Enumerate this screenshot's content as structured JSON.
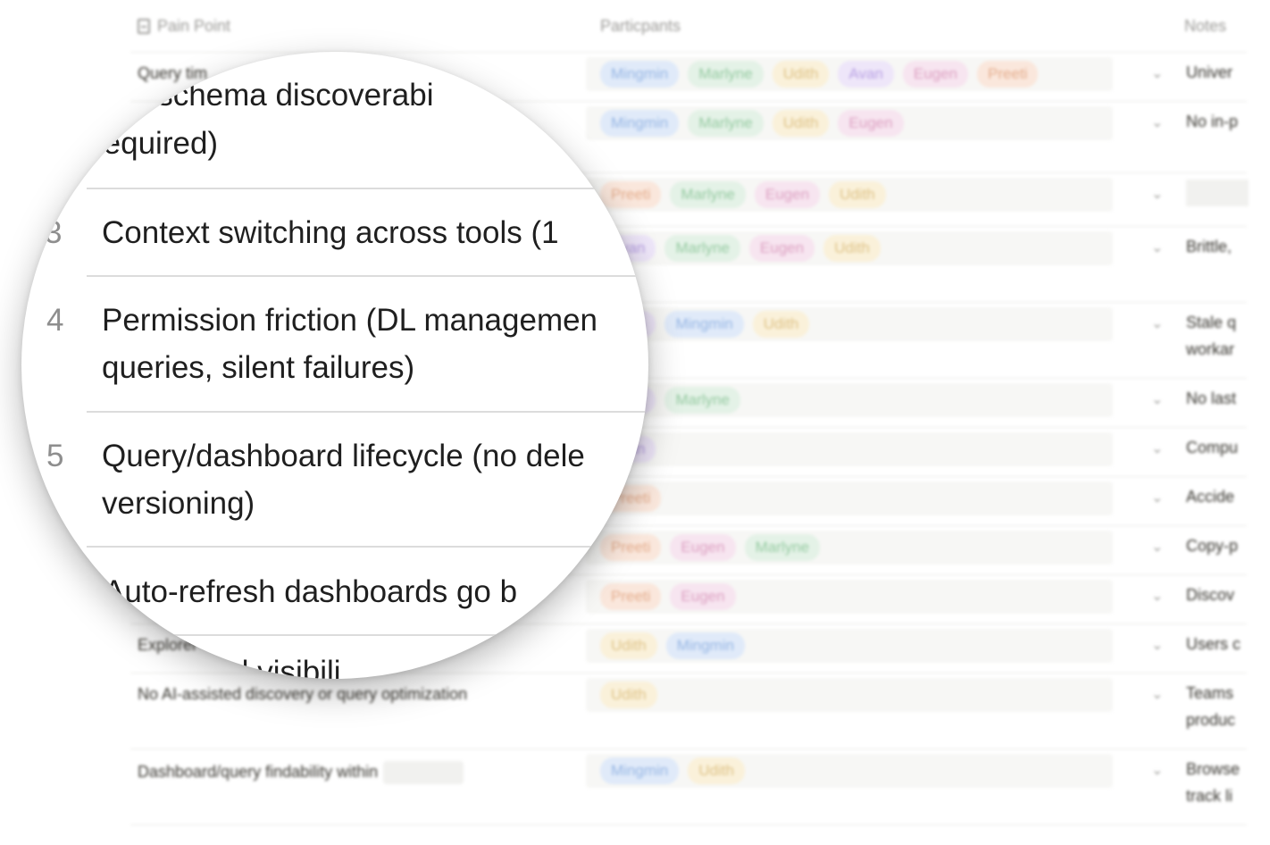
{
  "header": {
    "pain_point": "Pain Point",
    "participants": "Particpants",
    "notes": "Notes"
  },
  "colors": {
    "blue": "#dbe8fb",
    "green": "#e0f1e4",
    "yellow": "#fbf0d4",
    "purple": "#ece3fa",
    "pink": "#f8e1ef",
    "orange": "#fbe4d6"
  },
  "rows": [
    {
      "pain": "Query tim",
      "tags": [
        "Mingmin",
        "Marlyne",
        "Udith",
        "Avan",
        "Eugen",
        "Preeti"
      ],
      "note": "Univer"
    },
    {
      "pain": "",
      "tags": [
        "Mingmin",
        "Marlyne",
        "Udith",
        "Eugen"
      ],
      "note": "No in-p"
    },
    {
      "pain": "",
      "tags": [
        "Preeti",
        "Marlyne",
        "Eugen",
        "Udith"
      ],
      "note": ""
    },
    {
      "pain": "",
      "tags": [
        "Avan",
        "Marlyne",
        "Eugen",
        "Udith"
      ],
      "note": "Brittle,"
    },
    {
      "pain": "",
      "tags": [
        "Avan",
        "Mingmin",
        "Udith"
      ],
      "note": "Stale q",
      "note2": "workar"
    },
    {
      "pain": "",
      "tags": [
        "Avan",
        "Marlyne"
      ],
      "note": "No last"
    },
    {
      "pain": "",
      "tags": [
        "Avan"
      ],
      "note": "Compu"
    },
    {
      "pain": "",
      "tags": [
        "Preeti"
      ],
      "note": "Accide"
    },
    {
      "pain": "",
      "tags": [
        "Preeti",
        "Eugen",
        "Marlyne"
      ],
      "note": "Copy-p"
    },
    {
      "pain": "",
      "tags": [
        "Preeti",
        "Eugen"
      ],
      "note": "Discov"
    },
    {
      "pain": "Explorer",
      "tags": [
        "Udith",
        "Mingmin"
      ],
      "note": "Users c"
    },
    {
      "pain": "No AI-assisted discovery or query optimization",
      "tags": [
        "Udith"
      ],
      "note": "Teams",
      "note2": "produc"
    },
    {
      "pain": "Dashboard/query findability within",
      "tags": [
        "Mingmin",
        "Udith"
      ],
      "note": "Browse",
      "note2": "track li"
    }
  ],
  "magnifier": {
    "row2_line1": "…e/schema discoverabi",
    "row2_line2": "required)",
    "row3_num": "3",
    "row3_text": "Context switching across tools (1",
    "row4_num": "4",
    "row4_line1": "Permission friction (DL managemen",
    "row4_line2": "queries, silent failures)",
    "row5_num": "5",
    "row5_line1": "Query/dashboard lifecycle (no dele",
    "row5_line2": "versioning)",
    "row6_text": "Auto-refresh dashboards go b",
    "row7_text": "…d visibili"
  }
}
